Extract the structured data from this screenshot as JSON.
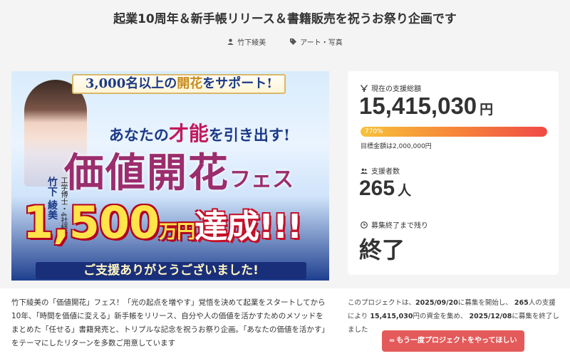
{
  "page": {
    "title": "起業10周年＆新手帳リリース＆書籍販売を祝うお祭り企画です",
    "author": "竹下綾美",
    "category": "アート・写真"
  },
  "hero": {
    "top_pre": "3,000名以上の",
    "top_accent": "開花",
    "top_post": "をサポート!",
    "side_title": "工学博士・4社経営",
    "side_name": "竹下 綾美",
    "sub_pre": "あなたの",
    "sub_big": "才能",
    "sub_post": "を引き出す!",
    "main_big": "価値開花",
    "main_small": "フェス",
    "achieve_num": "1,500",
    "achieve_unit": "万円",
    "achieve_word": "達成!!!",
    "thanks": "ご支援ありがとうございました!"
  },
  "stats": {
    "total_label": "現在の支援総額",
    "total_value": "15,415,030",
    "total_unit": "円",
    "progress_percent": 770,
    "progress_text": "770%",
    "goal_text": "目標金額は2,000,000円",
    "backers_label": "支援者数",
    "backers_value": "265",
    "backers_unit": "人",
    "remain_label": "募集終了まで残り",
    "remain_value": "終了"
  },
  "description": "竹下綾美の「価値開花」フェス！「光の起点を増やす」覚悟を決めて起業をスタートしてから10年、「時間を価値に変える」新手帳をリリース、自分や人の価値を活かすためのメソッドをまとめた「任せる」書籍発売と、トリプルな記念を祝うお祭り企画。「あなたの価値を活かす」をテーマにしたリターンを多数ご用意しています",
  "summary": {
    "p1": "このプロジェクトは、",
    "start": "2025/09/20",
    "p2": "に募集を開始し、",
    "backers": "265",
    "p3": "人の支援により",
    "amount": "15,415,030",
    "p4": "円の資金を集め、",
    "end": "2025/12/08",
    "p5": "に募集を終了しました"
  },
  "cta": {
    "label": "∞ もう一度プロジェクトをやってほしい"
  },
  "colors": {
    "cta": "#e45a5a",
    "progress_start": "#f7c23a",
    "progress_end": "#f04a46"
  },
  "icons": [
    "user-icon",
    "tag-icon",
    "yen-icon",
    "users-icon",
    "clock-icon",
    "infinity-icon"
  ]
}
